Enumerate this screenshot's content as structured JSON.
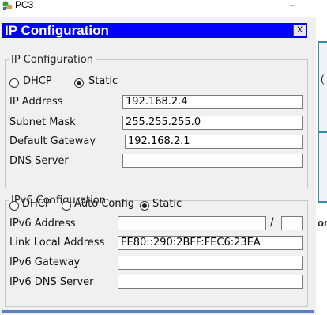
{
  "window": {
    "title": "PC3",
    "minimize_glyph": "–"
  },
  "dialog": {
    "title": "IP Configuration",
    "close_label": "X",
    "ipv4": {
      "legend": "IP Configuration",
      "mode_dhcp": "DHCP",
      "mode_static": "Static",
      "selected_mode": "Static",
      "ip_address_label": "IP Address",
      "ip_address": "192.168.2.4",
      "subnet_mask_label": "Subnet Mask",
      "subnet_mask": "255.255.255.0",
      "default_gateway_label": "Default Gateway",
      "default_gateway": "192.168.2.1",
      "dns_server_label": "DNS Server",
      "dns_server": ""
    },
    "ipv6": {
      "legend": "IPv6 Configuration",
      "mode_dhcp": "DHCP",
      "mode_auto": "Auto Config",
      "mode_static": "Static",
      "selected_mode": "Static",
      "address_label": "IPv6 Address",
      "address": "",
      "prefix_separator": "/",
      "prefix_length": "",
      "link_local_label": "Link Local Address",
      "link_local": "FE80::290:2BFF:FEC6:23EA",
      "gateway_label": "IPv6 Gateway",
      "gateway": "",
      "dns_server_label": "IPv6 DNS Server",
      "dns_server": ""
    }
  },
  "background": {
    "letter_a": "(",
    "letter_b": "or"
  },
  "colors": {
    "dialog_title_bar": "#0000ff",
    "panel_border": "#2e8fa3"
  }
}
